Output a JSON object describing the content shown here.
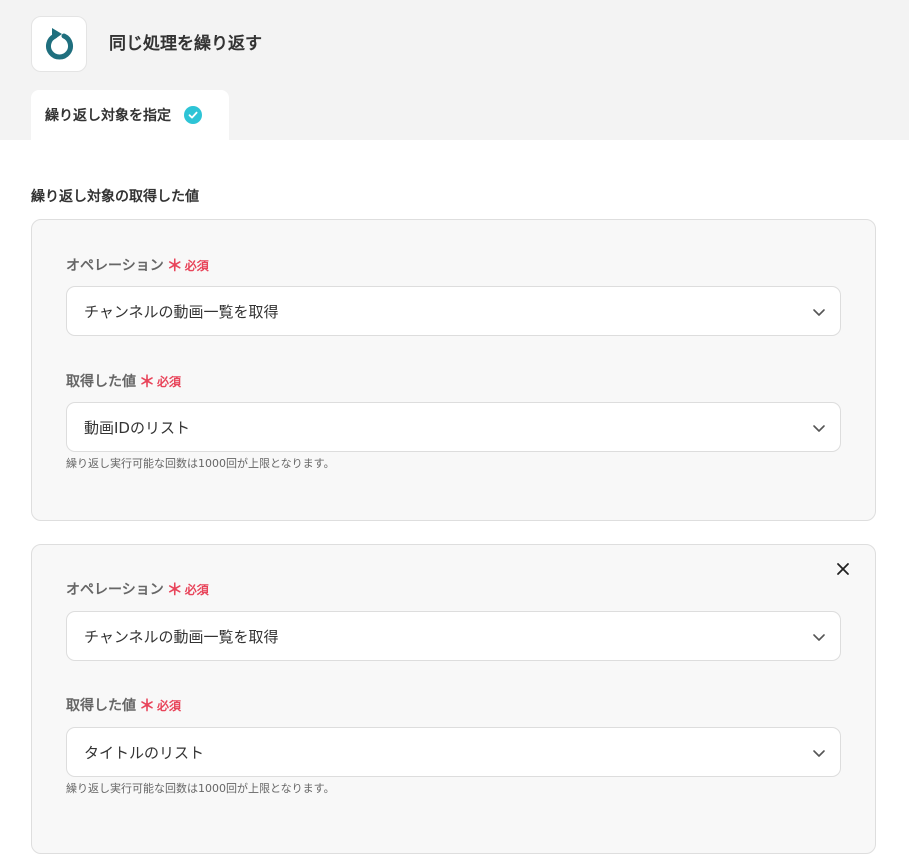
{
  "header": {
    "title": "同じ処理を繰り返す",
    "tab_label": "繰り返し対象を指定"
  },
  "section": {
    "title": "繰り返し対象の取得した値"
  },
  "required_mark": "＊",
  "required_text": "必須",
  "cards": [
    {
      "operation_label": "オペレーション",
      "operation_value": "チャンネルの動画一覧を取得",
      "value_label": "取得した値",
      "value_value": "動画IDのリスト",
      "hint": "繰り返し実行可能な回数は1000回が上限となります。"
    },
    {
      "operation_label": "オペレーション",
      "operation_value": "チャンネルの動画一覧を取得",
      "value_label": "取得した値",
      "value_value": "タイトルのリスト",
      "hint": "繰り返し実行可能な回数は1000回が上限となります。"
    }
  ],
  "colors": {
    "accent_teal": "#1f6f7e",
    "check_cyan": "#2ec4d6",
    "required_red": "#e8445a"
  },
  "icons": {
    "app": "repeat-arrow-icon",
    "tab_status": "check-circle-icon",
    "dropdown": "chevron-down-icon",
    "remove": "close-icon"
  }
}
